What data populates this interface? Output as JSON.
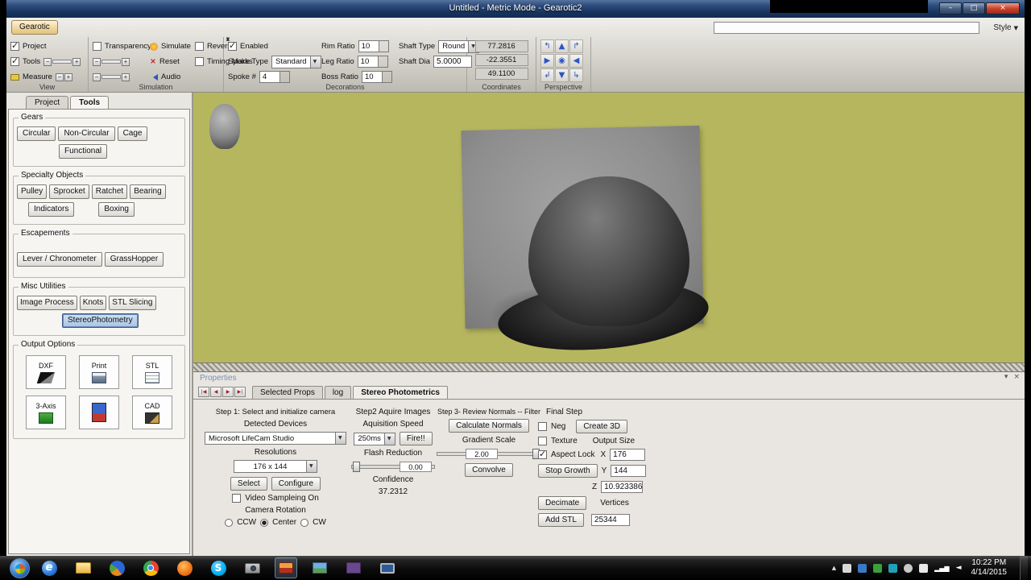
{
  "window": {
    "title": "Untitled - Metric Mode - Gearotic2"
  },
  "icons": {
    "minimize": "–",
    "maximize": "□",
    "close": "×",
    "style_arrow": "▼",
    "minus": "−",
    "plus": "+",
    "reset_glyph": "×",
    "ie_glyph": "e",
    "skype_glyph": "S",
    "tray_expand": "▲",
    "network_glyph": "▂▄▆",
    "volume_glyph": "◄",
    "props_collapse": "▾",
    "props_close": "×"
  },
  "ribbon": {
    "app_button": "Gearotic",
    "style_label": "Style",
    "view": {
      "label": "View",
      "project": "Project",
      "tools": "Tools",
      "measure": "Measure"
    },
    "simulation": {
      "label": "Simulation",
      "transparency": "Transparency",
      "simulate": "Simulate",
      "reset": "Reset",
      "audio": "Audio",
      "reverse": "Reverse",
      "timing_marks": "Timing Marks"
    },
    "decorations": {
      "label": "Decorations",
      "enabled": "Enabled",
      "spoke_type": "Spoke Type",
      "spoke_type_value": "Standard",
      "spoke_count_label": "Spoke #",
      "spoke_count": "4",
      "rim_ratio": "Rim Ratio",
      "rim_ratio_value": "10",
      "leg_ratio": "Leg Ratio",
      "leg_ratio_value": "10",
      "boss_ratio": "Boss Ratio",
      "boss_ratio_value": "10",
      "shaft_type": "Shaft Type",
      "shaft_type_value": "Round",
      "shaft_dia": "Shaft Dia",
      "shaft_dia_value": "5.0000"
    },
    "coordinates": {
      "label": "Coordinates",
      "x": "77.2816",
      "y": "-22.3551",
      "z": "49.1100"
    },
    "perspective": {
      "label": "Perspective",
      "arrows": [
        "↰",
        "▲",
        "↱",
        "▶",
        "◉",
        "◀",
        "↲",
        "▼",
        "↳"
      ]
    }
  },
  "sidebar": {
    "tabs": [
      "Project",
      "Tools"
    ],
    "gears": {
      "label": "Gears",
      "buttons": [
        "Circular",
        "Non-Circular",
        "Cage",
        "Functional"
      ]
    },
    "specialty": {
      "label": "Specialty Objects",
      "row1": [
        "Pulley",
        "Sprocket",
        "Ratchet",
        "Bearing"
      ],
      "row2": [
        "Indicators",
        "Boxing"
      ]
    },
    "escapements": {
      "label": "Escapements",
      "buttons": [
        "Lever / Chronometer",
        "GrassHopper"
      ]
    },
    "misc": {
      "label": "Misc Utilities",
      "row1": [
        "Image Process",
        "Knots",
        "STL Slicing"
      ],
      "selected": "StereoPhotometry"
    },
    "output": {
      "label": "Output Options",
      "dxf": "DXF",
      "print": "Print",
      "stl": "STL",
      "axis3": "3-Axis",
      "cad": "CAD"
    }
  },
  "properties": {
    "title": "Properties",
    "vcr": [
      "|◀",
      "◀",
      "▶",
      "▶|"
    ],
    "tabs": [
      "Selected Props",
      "log",
      "Stereo Photometrics"
    ],
    "step1": {
      "title": "Step 1: Select and initialize camera",
      "detected": "Detected Devices",
      "device": "Microsoft LifeCam Studio",
      "resolutions": "Resolutions",
      "resolution": "176 x 144",
      "select_btn": "Select",
      "configure_btn": "Configure",
      "video_sampling": "Video Sampleing On",
      "camera_rotation": "Camera Rotation",
      "ccw": "CCW",
      "center": "Center",
      "cw": "CW"
    },
    "step2": {
      "title": "Step2 Aquire Images",
      "speed_label": "Aquisition Speed",
      "speed": "250ms",
      "fire_btn": "Fire!!",
      "flash_label": "Flash Reduction",
      "flash_value": "0.00",
      "confidence_label": "Confidence",
      "confidence_value": "37.2312"
    },
    "step3": {
      "title": "Step 3- Review Normals -- Filter",
      "calc_btn": "Calculate Normals",
      "gradient_label": "Gradient Scale",
      "gradient_value": "2.00",
      "convolve_btn": "Convolve"
    },
    "final": {
      "title": "Final Step",
      "neg": "Neg",
      "create3d_btn": "Create 3D",
      "texture": "Texture",
      "output_size": "Output Size",
      "aspect_lock": "Aspect Lock",
      "x_label": "X",
      "x_value": "176",
      "y_label": "Y",
      "y_value": "144",
      "z_label": "Z",
      "z_value": "10.923386",
      "stop_growth_btn": "Stop Growth",
      "decimate_btn": "Decimate",
      "vertices_label": "Vertices",
      "vertices_value": "25344",
      "add_stl_btn": "Add STL"
    }
  },
  "taskbar": {
    "time": "10:22 PM",
    "date": "4/14/2015"
  }
}
